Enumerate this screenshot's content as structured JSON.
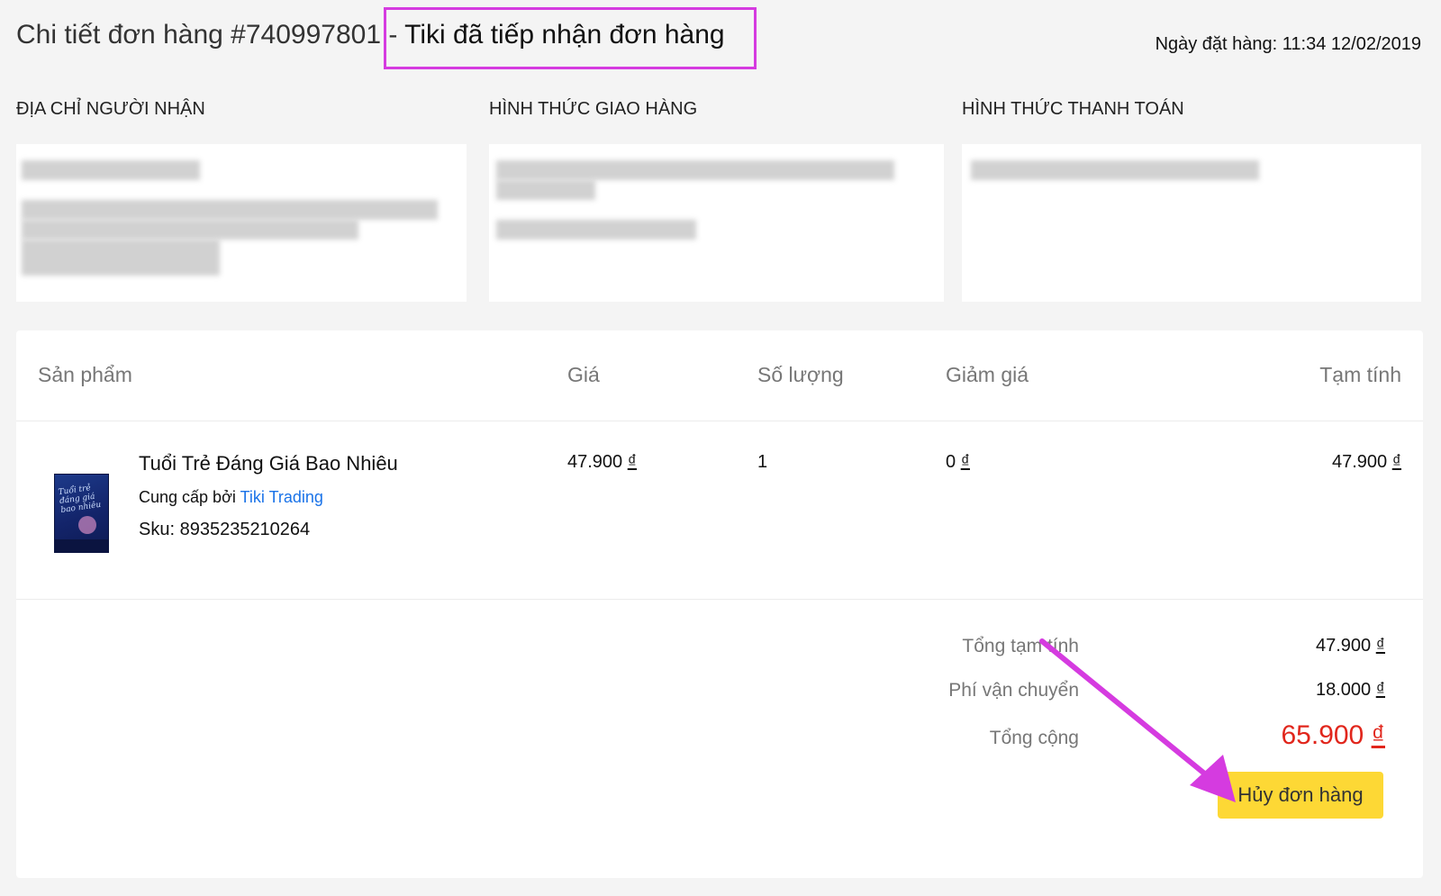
{
  "header": {
    "order_title": "Chi tiết đơn hàng #740997801",
    "separator": " - ",
    "status": "Tiki đã tiếp nhận đơn hàng",
    "order_date": "Ngày đặt hàng: 11:34 12/02/2019"
  },
  "sections": {
    "recipient_address": "ĐỊA CHỈ NGƯỜI NHẬN",
    "shipping_method": "HÌNH THỨC GIAO HÀNG",
    "payment_method": "HÌNH THỨC THANH TOÁN"
  },
  "table": {
    "headers": [
      "Sản phẩm",
      "Giá",
      "Số lượng",
      "Giảm giá",
      "Tạm tính"
    ],
    "items": [
      {
        "name": "Tuổi Trẻ Đáng Giá Bao Nhiêu",
        "supplier_prefix": "Cung cấp bởi",
        "supplier": "Tiki Trading",
        "sku": "Sku: 8935235210264",
        "price": "47.900",
        "quantity": "1",
        "discount": "0",
        "subtotal": "47.900",
        "currency": "₫",
        "cover_text": [
          "Tuổi trẻ",
          "đáng giá",
          "bao nhiêu"
        ]
      }
    ]
  },
  "totals": {
    "subtotal_label": "Tổng tạm tính",
    "subtotal_value": "47.900",
    "shipping_label": "Phí vận chuyển",
    "shipping_value": "18.000",
    "total_label": "Tổng cộng",
    "total_value": "65.900",
    "currency": "₫"
  },
  "actions": {
    "cancel_label": "Hủy đơn hàng"
  },
  "colors": {
    "highlight": "#d53be0",
    "total": "#e1261c",
    "button": "#fdd835",
    "link": "#1a73e8"
  }
}
